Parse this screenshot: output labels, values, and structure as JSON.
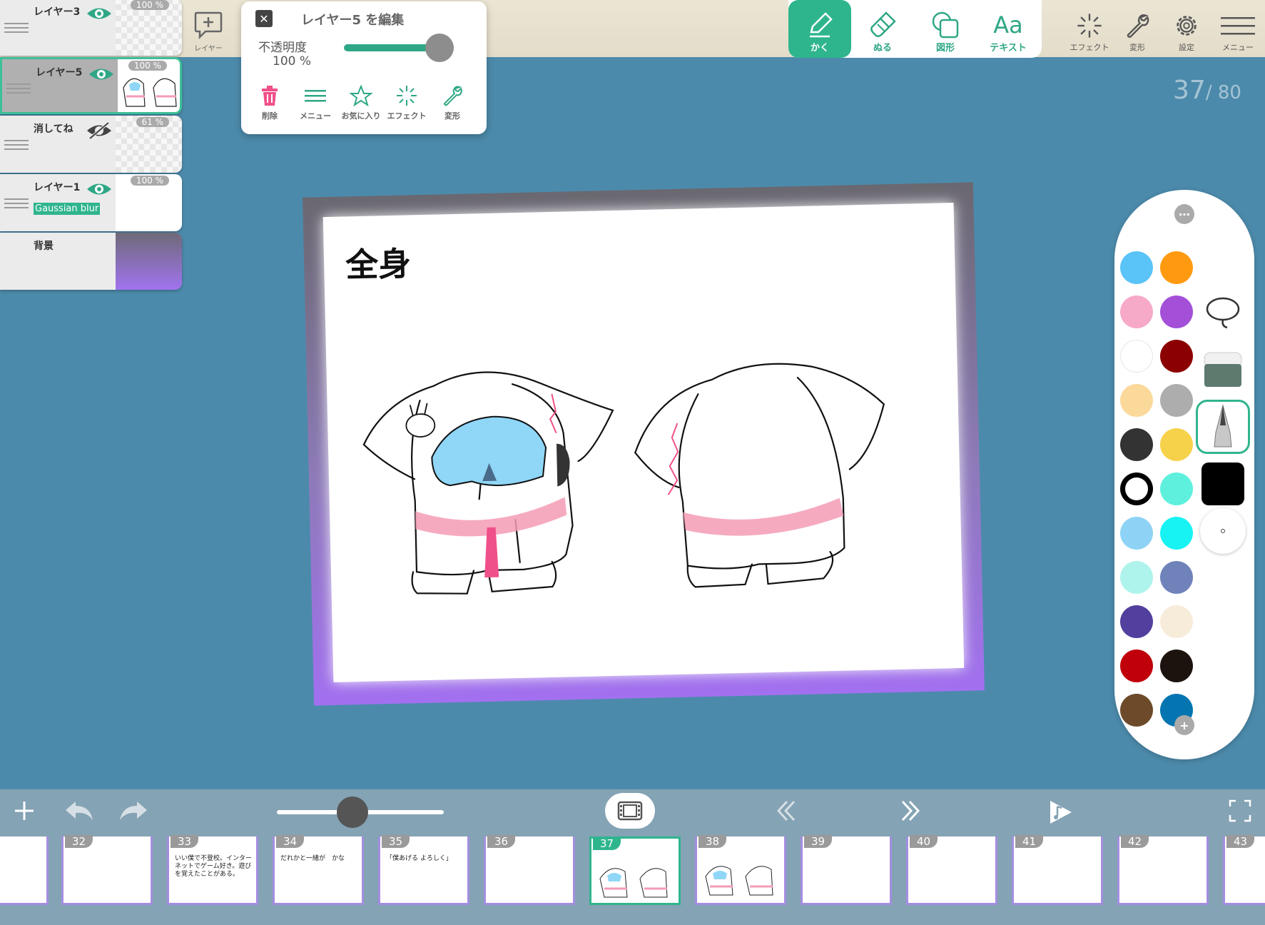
{
  "layers": [
    {
      "name": "レイヤー3",
      "opacity": "100 %",
      "visible": true,
      "selected": false
    },
    {
      "name": "レイヤー5",
      "opacity": "100 %",
      "visible": true,
      "selected": true
    },
    {
      "name": "消してね",
      "opacity": "61 %",
      "visible": false,
      "selected": false
    },
    {
      "name": "レイヤー1",
      "opacity": "100 %",
      "visible": true,
      "selected": false,
      "effect": "Gaussian blur"
    },
    {
      "name": "背景",
      "selected": false
    }
  ],
  "add_layer_label": "レイヤー",
  "edit_popup": {
    "title": "レイヤー5 を編集",
    "opacity_label": "不透明度",
    "opacity_value": "100 %",
    "opacity_level": 1.0,
    "actions": [
      "削除",
      "メニュー",
      "お気に入り",
      "エフェクト",
      "変形"
    ]
  },
  "tools": [
    {
      "label": "かく",
      "icon": "pen-icon",
      "active": true
    },
    {
      "label": "ぬる",
      "icon": "bucket-icon",
      "active": false
    },
    {
      "label": "図形",
      "icon": "shape-icon",
      "active": false
    },
    {
      "label": "テキスト",
      "icon": "text-icon",
      "glyph": "Aa",
      "active": false
    }
  ],
  "right_tools": [
    {
      "label": "エフェクト",
      "icon": "sparkle-icon"
    },
    {
      "label": "変形",
      "icon": "wrench-icon"
    },
    {
      "label": "設定",
      "icon": "gear-icon"
    },
    {
      "label": "メニュー",
      "icon": "menu-icon"
    }
  ],
  "page_counter": {
    "current": "37",
    "total": "/ 80"
  },
  "canvas": {
    "title": "全身"
  },
  "palette": {
    "colors": [
      "#5ac3f7",
      "#ff9a10",
      "#f7a9c8",
      "#a34fd8",
      "#ffffff",
      "#8b0000",
      "#fbd99a",
      "#adadad",
      "#333333",
      "#f6d24a",
      "#ffffff",
      "#5ff0dd",
      "#8ed3f5",
      "#17f3f3",
      "#aef4ec",
      "#6f82ba",
      "#523f9e",
      "#f7ecd9",
      "#c0000a",
      "#1d130e",
      "#6d4b2a",
      "#0475b0"
    ],
    "selected_color_index": 10,
    "brushes": [
      "lasso-icon",
      "eraser-icon",
      "pen-nib-icon",
      "black-swatch",
      "dot-size"
    ]
  },
  "timeline": {
    "current_frame": "37",
    "frames": [
      {
        "num": "",
        "text": ""
      },
      {
        "num": "32",
        "text": ""
      },
      {
        "num": "33",
        "text": "いい僕で不登校。インターネットでゲーム好き。遊びを覚えたことがある。"
      },
      {
        "num": "34",
        "text": "だれかと一緒が　かな"
      },
      {
        "num": "35",
        "text": "「僕あげる よろしく」"
      },
      {
        "num": "36",
        "text": ""
      },
      {
        "num": "37",
        "text": ""
      },
      {
        "num": "38",
        "text": ""
      },
      {
        "num": "39",
        "text": ""
      },
      {
        "num": "40",
        "text": ""
      },
      {
        "num": "41",
        "text": ""
      },
      {
        "num": "42",
        "text": ""
      },
      {
        "num": "43",
        "text": ""
      }
    ]
  }
}
